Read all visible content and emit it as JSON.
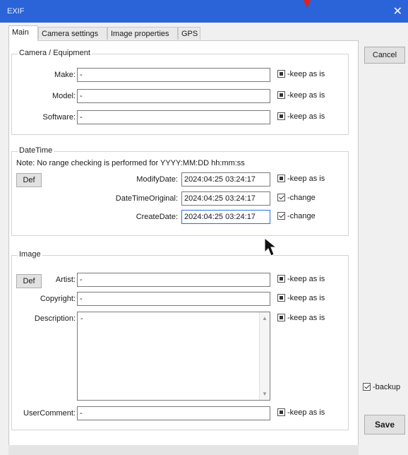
{
  "window": {
    "title": "EXIF",
    "close_glyph": "✕"
  },
  "tabs": [
    {
      "label": "Main",
      "active": true
    },
    {
      "label": "Camera settings",
      "active": false
    },
    {
      "label": "Image properties",
      "active": false
    },
    {
      "label": "GPS",
      "active": false
    }
  ],
  "camera": {
    "group_title": "Camera / Equipment",
    "rows": [
      {
        "label": "Make:",
        "value": "-",
        "option": "-keep as is"
      },
      {
        "label": "Model:",
        "value": "-",
        "option": "-keep as is"
      },
      {
        "label": "Software:",
        "value": "-",
        "option": "-keep as is"
      }
    ]
  },
  "datetime": {
    "group_title": "DateTime",
    "note": "Note: No range checking is performed for YYYY:MM:DD hh:mm:ss",
    "def_label": "Def",
    "rows": [
      {
        "label": "ModifyDate:",
        "value": "2024:04:25 03:24:17",
        "option": "-keep as is"
      },
      {
        "label": "DateTimeOriginal:",
        "value": "2024:04:25 03:24:17",
        "option": "-change"
      },
      {
        "label": "CreateDate:",
        "value": "2024:04:25 03:24:17",
        "option": "-change"
      }
    ]
  },
  "image": {
    "group_title": "Image",
    "def_label": "Def",
    "artist": {
      "label": "Artist:",
      "value": "-",
      "option": "-keep as is"
    },
    "copyright": {
      "label": "Copyright:",
      "value": "-",
      "option": "-keep as is"
    },
    "description": {
      "label": "Description:",
      "value": "-",
      "option": "-keep as is"
    },
    "usercomment": {
      "label": "UserComment:",
      "value": "-",
      "option": "-keep as is"
    }
  },
  "side": {
    "cancel_label": "Cancel",
    "backup_label": "-backup",
    "save_label": "Save"
  },
  "colors": {
    "titlebar": "#2b63d9",
    "panel": "#ffffff",
    "window_bg": "#f0f0f0"
  },
  "icons": {
    "close": "close-icon",
    "pointer": "mouse-pointer-icon",
    "scroll_up": "chevron-up-icon",
    "scroll_down": "chevron-down-icon"
  }
}
